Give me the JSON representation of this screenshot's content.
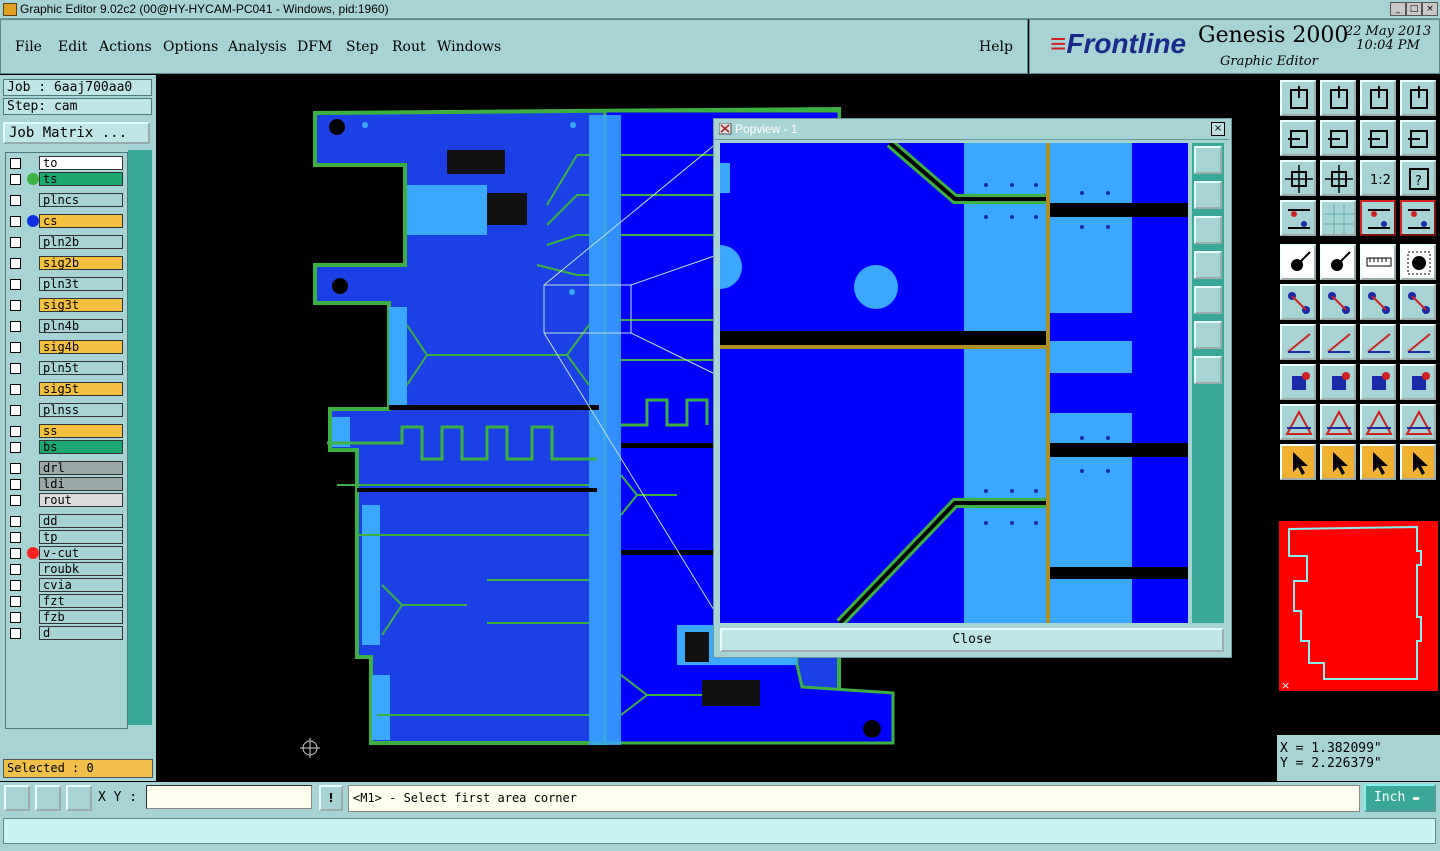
{
  "window": {
    "title": "Graphic Editor 9.02c2 (00@HY-HYCAM-PC041 - Windows, pid:1960)"
  },
  "menu": [
    "File",
    "Edit",
    "Actions",
    "Options",
    "Analysis",
    "DFM",
    "Step",
    "Rout",
    "Windows"
  ],
  "help": "Help",
  "brand": {
    "logo": "Frontline",
    "product": "Genesis 2000",
    "subtitle": "Graphic Editor",
    "date": "22 May 2013",
    "time": "10:04 PM"
  },
  "job": {
    "job_line": "Job : 6aaj700aa0",
    "step_line": "Step: cam",
    "matrix_button": "Job Matrix ..."
  },
  "layers": [
    {
      "name": "to",
      "color": "#ffffff",
      "dot": ""
    },
    {
      "name": "ts",
      "color": "#1aa870",
      "dot": "#3cb040"
    },
    {
      "name": "plncs",
      "color": "#a6d4d4",
      "dot": ""
    },
    {
      "name": "cs",
      "color": "#f4c040",
      "dot": "#1030e0"
    },
    {
      "name": "pln2b",
      "color": "#a6d4d4",
      "dot": ""
    },
    {
      "name": "sig2b",
      "color": "#f4c040",
      "dot": ""
    },
    {
      "name": "pln3t",
      "color": "#a6d4d4",
      "dot": ""
    },
    {
      "name": "sig3t",
      "color": "#f4c040",
      "dot": ""
    },
    {
      "name": "pln4b",
      "color": "#a6d4d4",
      "dot": ""
    },
    {
      "name": "sig4b",
      "color": "#f4c040",
      "dot": ""
    },
    {
      "name": "pln5t",
      "color": "#a6d4d4",
      "dot": ""
    },
    {
      "name": "sig5t",
      "color": "#f4c040",
      "dot": ""
    },
    {
      "name": "plnss",
      "color": "#a6d4d4",
      "dot": ""
    },
    {
      "name": "ss",
      "color": "#f4c040",
      "dot": ""
    },
    {
      "name": "bs",
      "color": "#1aa870",
      "dot": ""
    },
    {
      "name": "drl",
      "color": "#9aa8a8",
      "dot": ""
    },
    {
      "name": "ldi",
      "color": "#9aa8a8",
      "dot": ""
    },
    {
      "name": "rout",
      "color": "#dcdcdc",
      "dot": ""
    },
    {
      "name": "dd",
      "color": "#a6d4d4",
      "dot": ""
    },
    {
      "name": "tp",
      "color": "#a6d4d4",
      "dot": ""
    },
    {
      "name": "v-cut",
      "color": "#a6d4d4",
      "dot": "#ff2020"
    },
    {
      "name": "roubk",
      "color": "#a6d4d4",
      "dot": ""
    },
    {
      "name": "cvia",
      "color": "#a6d4d4",
      "dot": ""
    },
    {
      "name": "fzt",
      "color": "#a6d4d4",
      "dot": ""
    },
    {
      "name": "fzb",
      "color": "#a6d4d4",
      "dot": ""
    },
    {
      "name": "d",
      "color": "#a6d4d4",
      "dot": ""
    }
  ],
  "selected": "Selected : 0",
  "popview": {
    "title": "Popview - 1",
    "close_label": "Close"
  },
  "coords": {
    "x": "X = 1.382099\"",
    "y": "Y = 2.226379\""
  },
  "bottom": {
    "xy_label": "X Y :",
    "xy_value": "",
    "bang": "!",
    "prompt": "<M1> - Select first area corner",
    "unit": "Inch"
  },
  "colors": {
    "panel": "#a6d4d4",
    "copper": "#0000ff",
    "light_copper": "#3aa8ff",
    "outline": "#3cb040",
    "highlight": "#f4c040"
  }
}
